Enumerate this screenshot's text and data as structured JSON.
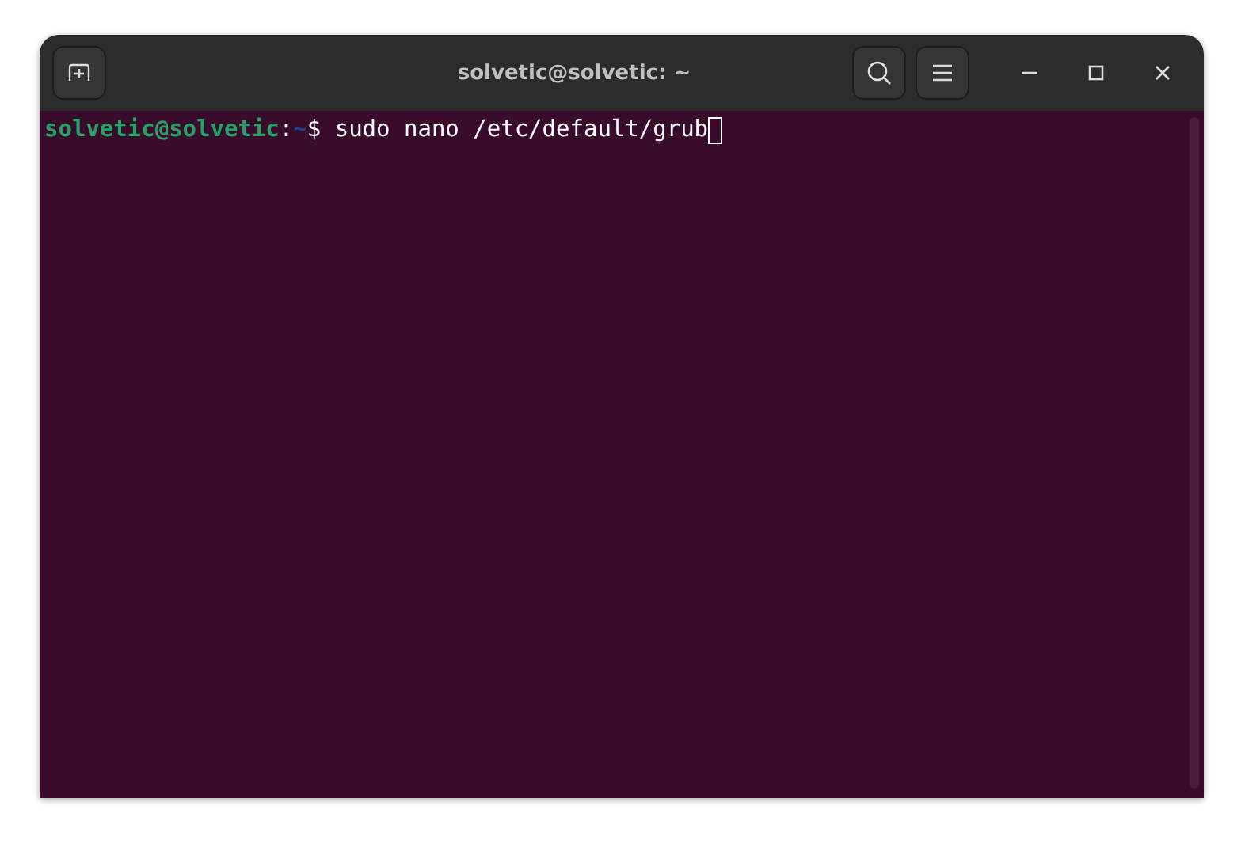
{
  "window": {
    "title": "solvetic@solvetic: ~"
  },
  "terminal": {
    "lines": [
      {
        "user_host": "solvetic@solvetic",
        "separator": ":",
        "path": "~",
        "symbol": "$",
        "command": " sudo nano /etc/default/grub",
        "cursor": true
      }
    ]
  }
}
